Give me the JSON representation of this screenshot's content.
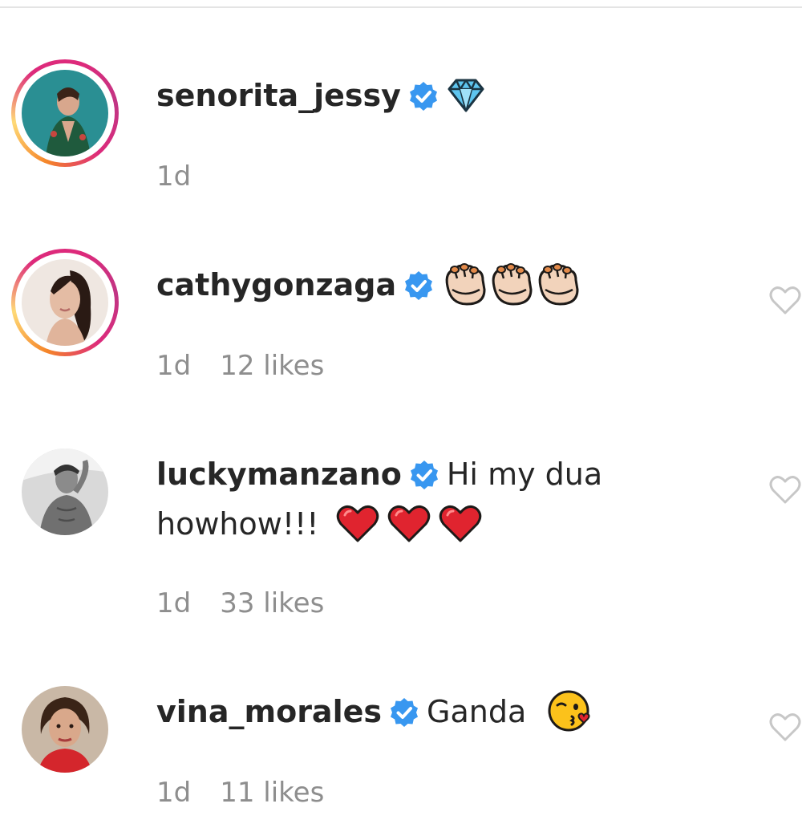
{
  "comments": [
    {
      "username": "senorita_jessy",
      "verified": true,
      "text": "",
      "emojis": [
        "gem-stone"
      ],
      "time": "1d",
      "likes": "",
      "story_ring": true
    },
    {
      "username": "cathygonzaga",
      "verified": true,
      "text": "",
      "emojis": [
        "clapping-hands",
        "clapping-hands",
        "clapping-hands"
      ],
      "time": "1d",
      "likes": "12 likes",
      "story_ring": true
    },
    {
      "username": "luckymanzano",
      "verified": true,
      "text": "Hi my dua",
      "text_line2": "howhow!!!",
      "emojis": [
        "red-heart",
        "red-heart",
        "red-heart"
      ],
      "time": "1d",
      "likes": "33 likes",
      "story_ring": false
    },
    {
      "username": "vina_morales",
      "verified": true,
      "text": "Ganda",
      "emojis": [
        "face-blowing-kiss"
      ],
      "time": "1d",
      "likes": "11 likes",
      "story_ring": false
    }
  ],
  "colors": {
    "verified_badge": "#3897f0",
    "meta_text": "#8e8e8e",
    "username_text": "#262626",
    "heart_emoji": "#e0242f",
    "like_icon": "#c7c7c7"
  }
}
